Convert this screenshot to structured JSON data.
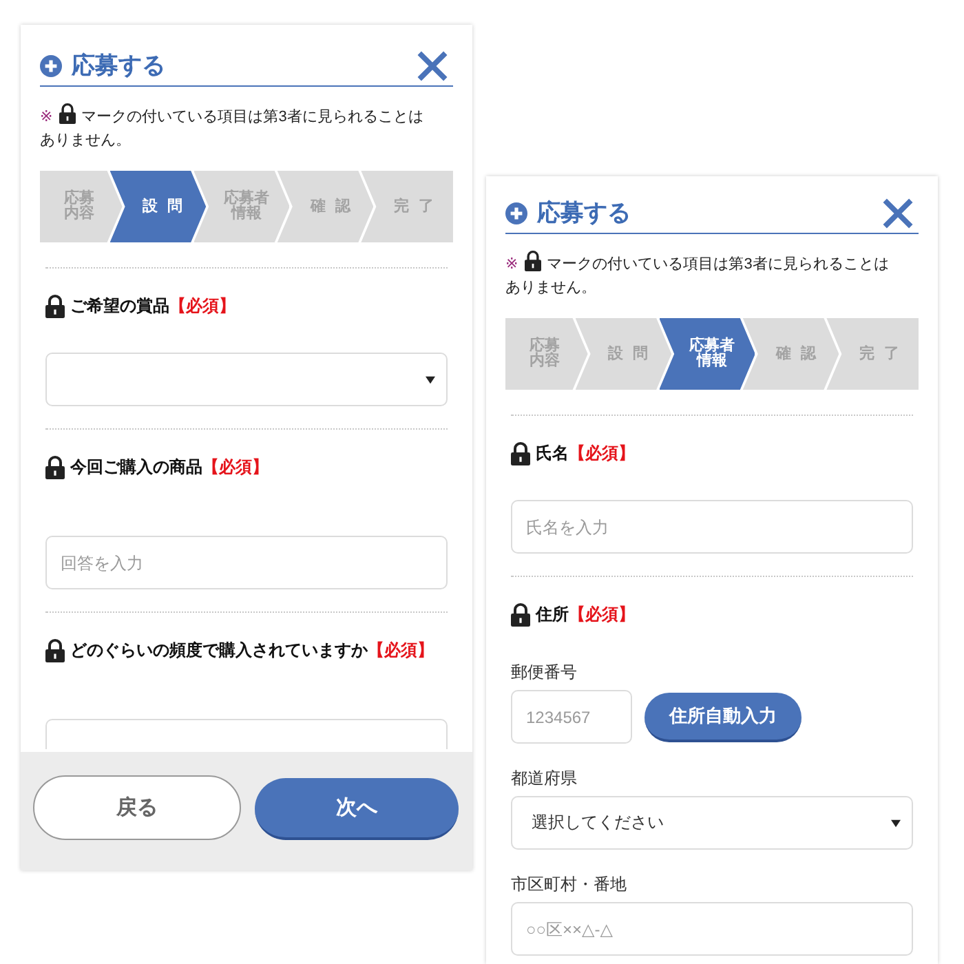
{
  "panels": [
    {
      "title": "応募する",
      "notice": {
        "mark": "※",
        "text": "マークの付いている項目は第3者に見られることはありません。"
      },
      "steps": [
        {
          "label": "応募内容",
          "current": false
        },
        {
          "label": "設 問",
          "current": true
        },
        {
          "label": "応募者情報",
          "current": false
        },
        {
          "label": "確 認",
          "current": false
        },
        {
          "label": "完 了",
          "current": false
        }
      ],
      "questions": [
        {
          "label": "ご希望の賞品",
          "required": "【必須】",
          "locked": true,
          "fields": [
            {
              "kind": "select"
            }
          ]
        },
        {
          "label": "今回ご購入の商品",
          "required": "【必須】",
          "locked": true,
          "fields": [
            {
              "kind": "answer",
              "placeholder": "回答を入力"
            }
          ]
        },
        {
          "label": "どのぐらいの頻度で購入されていますか",
          "required": "【必須】",
          "locked": true,
          "fields": [
            {
              "kind": "answer"
            }
          ]
        }
      ],
      "footer": {
        "buttons": [
          {
            "label": "戻る",
            "kind": "secondary"
          },
          {
            "label": "次へ",
            "kind": "primary"
          }
        ]
      }
    },
    {
      "title": "応募する",
      "notice": {
        "mark": "※",
        "text": "マークの付いている項目は第3者に見られることはありません。"
      },
      "steps": [
        {
          "label": "応募内容",
          "current": false
        },
        {
          "label": "設 問",
          "current": false
        },
        {
          "label": "応募者情報",
          "current": true
        },
        {
          "label": "確 認",
          "current": false
        },
        {
          "label": "完 了",
          "current": false
        }
      ],
      "questions": [
        {
          "label": "氏名",
          "required": "【必須】",
          "locked": true,
          "fields": [
            {
              "kind": "text",
              "placeholder": "氏名を入力"
            }
          ]
        },
        {
          "label": "住所",
          "required": "【必須】",
          "locked": true,
          "fields": [
            {
              "label": "郵便番号",
              "kind": "postal",
              "placeholder": "1234567",
              "button": "住所自動入力"
            },
            {
              "label": "都道府県",
              "kind": "select",
              "value": "選択してください"
            },
            {
              "label": "市区町村・番地",
              "kind": "text",
              "placeholder": "○○区××△-△"
            }
          ]
        }
      ]
    }
  ]
}
